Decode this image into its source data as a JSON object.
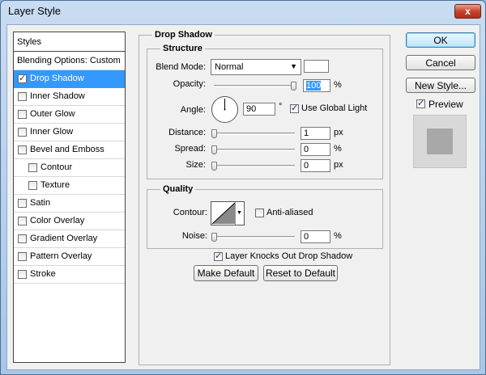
{
  "window": {
    "title": "Layer Style",
    "close_symbol": "x"
  },
  "styles_list": {
    "header": "Styles",
    "items": [
      {
        "label": "Blending Options: Custom",
        "checkbox": false,
        "checked": false,
        "indent": false,
        "selected": false
      },
      {
        "label": "Drop Shadow",
        "checkbox": true,
        "checked": true,
        "indent": false,
        "selected": true
      },
      {
        "label": "Inner Shadow",
        "checkbox": true,
        "checked": false,
        "indent": false,
        "selected": false
      },
      {
        "label": "Outer Glow",
        "checkbox": true,
        "checked": false,
        "indent": false,
        "selected": false
      },
      {
        "label": "Inner Glow",
        "checkbox": true,
        "checked": false,
        "indent": false,
        "selected": false
      },
      {
        "label": "Bevel and Emboss",
        "checkbox": true,
        "checked": false,
        "indent": false,
        "selected": false
      },
      {
        "label": "Contour",
        "checkbox": true,
        "checked": false,
        "indent": true,
        "selected": false
      },
      {
        "label": "Texture",
        "checkbox": true,
        "checked": false,
        "indent": true,
        "selected": false
      },
      {
        "label": "Satin",
        "checkbox": true,
        "checked": false,
        "indent": false,
        "selected": false
      },
      {
        "label": "Color Overlay",
        "checkbox": true,
        "checked": false,
        "indent": false,
        "selected": false
      },
      {
        "label": "Gradient Overlay",
        "checkbox": true,
        "checked": false,
        "indent": false,
        "selected": false
      },
      {
        "label": "Pattern Overlay",
        "checkbox": true,
        "checked": false,
        "indent": false,
        "selected": false
      },
      {
        "label": "Stroke",
        "checkbox": true,
        "checked": false,
        "indent": false,
        "selected": false
      }
    ]
  },
  "drop_shadow": {
    "title": "Drop Shadow",
    "structure": {
      "title": "Structure",
      "blend_mode_label": "Blend Mode:",
      "blend_mode_value": "Normal",
      "blend_color": "#ffffff",
      "opacity_label": "Opacity:",
      "opacity_value": "100",
      "opacity_unit": "%",
      "opacity_level": 1.0,
      "angle_label": "Angle:",
      "angle_value": "90",
      "angle_unit": "°",
      "use_global_light_label": "Use Global Light",
      "use_global_light": true,
      "distance_label": "Distance:",
      "distance_value": "1",
      "distance_unit": "px",
      "spread_label": "Spread:",
      "spread_value": "0",
      "spread_unit": "%",
      "size_label": "Size:",
      "size_value": "0",
      "size_unit": "px"
    },
    "quality": {
      "title": "Quality",
      "contour_label": "Contour:",
      "anti_aliased_label": "Anti-aliased",
      "anti_aliased": false,
      "noise_label": "Noise:",
      "noise_value": "0",
      "noise_unit": "%"
    },
    "knocks_out_label": "Layer Knocks Out Drop Shadow",
    "knocks_out": true,
    "make_default_label": "Make Default",
    "reset_default_label": "Reset to Default"
  },
  "actions": {
    "ok_label": "OK",
    "cancel_label": "Cancel",
    "new_style_label": "New Style...",
    "preview_label": "Preview",
    "preview_checked": true
  }
}
